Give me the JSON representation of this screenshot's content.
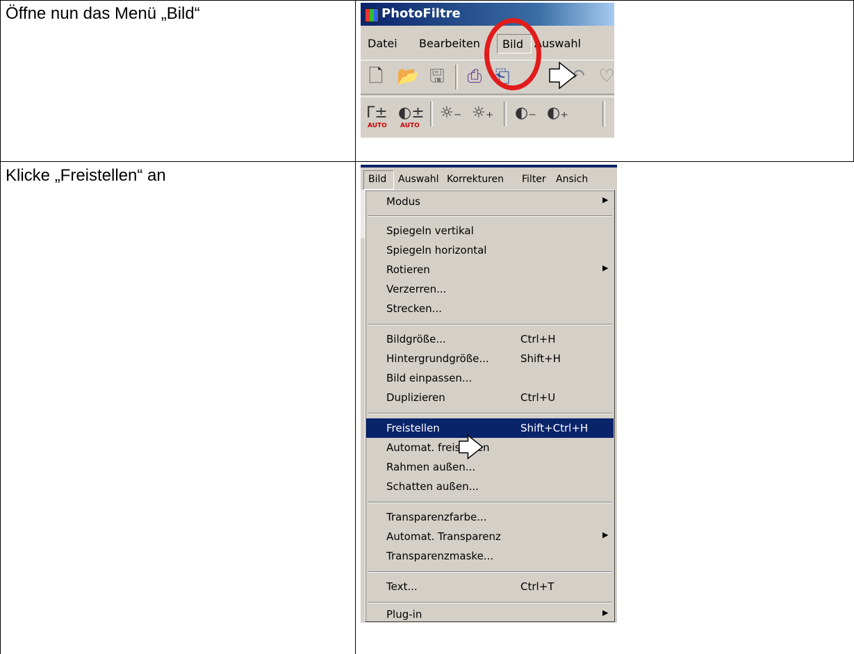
{
  "steps": [
    {
      "instruction": "Öffne nun das Menü „Bild“"
    },
    {
      "instruction": "Klicke „Freistellen“ an"
    }
  ],
  "screenshot1": {
    "app_title": "PhotoFiltre",
    "menu": [
      "Datei",
      "Bearbeiten",
      "Bild",
      "Auswahl"
    ],
    "highlighted_menu": "Bild",
    "auto_label": "AUTO",
    "annotation_color": "#e21b1b"
  },
  "screenshot2": {
    "menubar": [
      "Bild",
      "Auswahl",
      "Korrekturen",
      "Filter",
      "Ansich"
    ],
    "menu_items": {
      "modus": {
        "label": "Modus",
        "submenu": true
      },
      "spiegeln_vertikal": {
        "label": "Spiegeln vertikal"
      },
      "spiegeln_horizontal": {
        "label": "Spiegeln horizontal"
      },
      "rotieren": {
        "label": "Rotieren",
        "submenu": true
      },
      "verzerren": {
        "label": "Verzerren..."
      },
      "strecken": {
        "label": "Strecken..."
      },
      "bildgroesse": {
        "label": "Bildgröße...",
        "shortcut": "Ctrl+H"
      },
      "hintergrundgroesse": {
        "label": "Hintergrundgröße...",
        "shortcut": "Shift+H"
      },
      "bild_einpassen": {
        "label": "Bild einpassen..."
      },
      "duplizieren": {
        "label": "Duplizieren",
        "shortcut": "Ctrl+U"
      },
      "freistellen": {
        "label": "Freistellen",
        "shortcut": "Shift+Ctrl+H",
        "selected": true
      },
      "automat_freistellen": {
        "label": "Automat. freistellen"
      },
      "rahmen_aussen": {
        "label": "Rahmen außen..."
      },
      "schatten_aussen": {
        "label": "Schatten außen..."
      },
      "transparenzfarbe": {
        "label": "Transparenzfarbe..."
      },
      "automat_transparenz": {
        "label": "Automat. Transparenz",
        "submenu": true
      },
      "transparenzmaske": {
        "label": "Transparenzmaske..."
      },
      "text": {
        "label": "Text...",
        "shortcut": "Ctrl+T"
      },
      "plugin": {
        "label": "Plug-in",
        "submenu": true
      }
    },
    "selection_color": "#0a246a",
    "menu_background": "#d4d0c8"
  }
}
